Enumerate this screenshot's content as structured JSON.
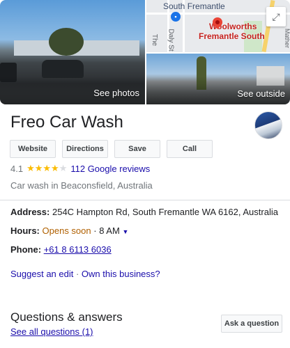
{
  "photos": {
    "see_photos_label": "See photos",
    "see_outside_label": "See outside",
    "map": {
      "town_label": "South Fremantle",
      "shop_line1": "Woolworths",
      "shop_line2": "Fremantle South",
      "street_label_1": "The",
      "street_label_2": "Daly St",
      "street_label_3": "Mather",
      "cart_icon": "cart-icon",
      "pin_icon": "map-pin-icon",
      "expand_icon": "expand-icon"
    }
  },
  "business": {
    "name": "Freo Car Wash",
    "rating": "4.1",
    "stars_filled": 4,
    "stars_total": 5,
    "reviews_label": "112 Google reviews",
    "category": "Car wash in Beaconsfield, Australia"
  },
  "actions": {
    "website": "Website",
    "directions": "Directions",
    "save": "Save",
    "call": "Call"
  },
  "info": {
    "address_label": "Address:",
    "address_value": "254C Hampton Rd, South Fremantle WA 6162, Australia",
    "hours_label": "Hours:",
    "hours_status": "Opens soon",
    "hours_separator": " · ",
    "hours_time": "8 AM",
    "phone_label": "Phone:",
    "phone_value": "+61 8 6113 6036"
  },
  "edit": {
    "suggest_label": "Suggest an edit",
    "separator": " · ",
    "own_label": "Own this business?"
  },
  "qa": {
    "title": "Questions & answers",
    "see_all_label": "See all questions (1)",
    "ask_label": "Ask a question"
  },
  "colors": {
    "link": "#1a0dab",
    "star": "#fbbc04",
    "hours_status": "#b06000",
    "pin": "#ea4335"
  }
}
